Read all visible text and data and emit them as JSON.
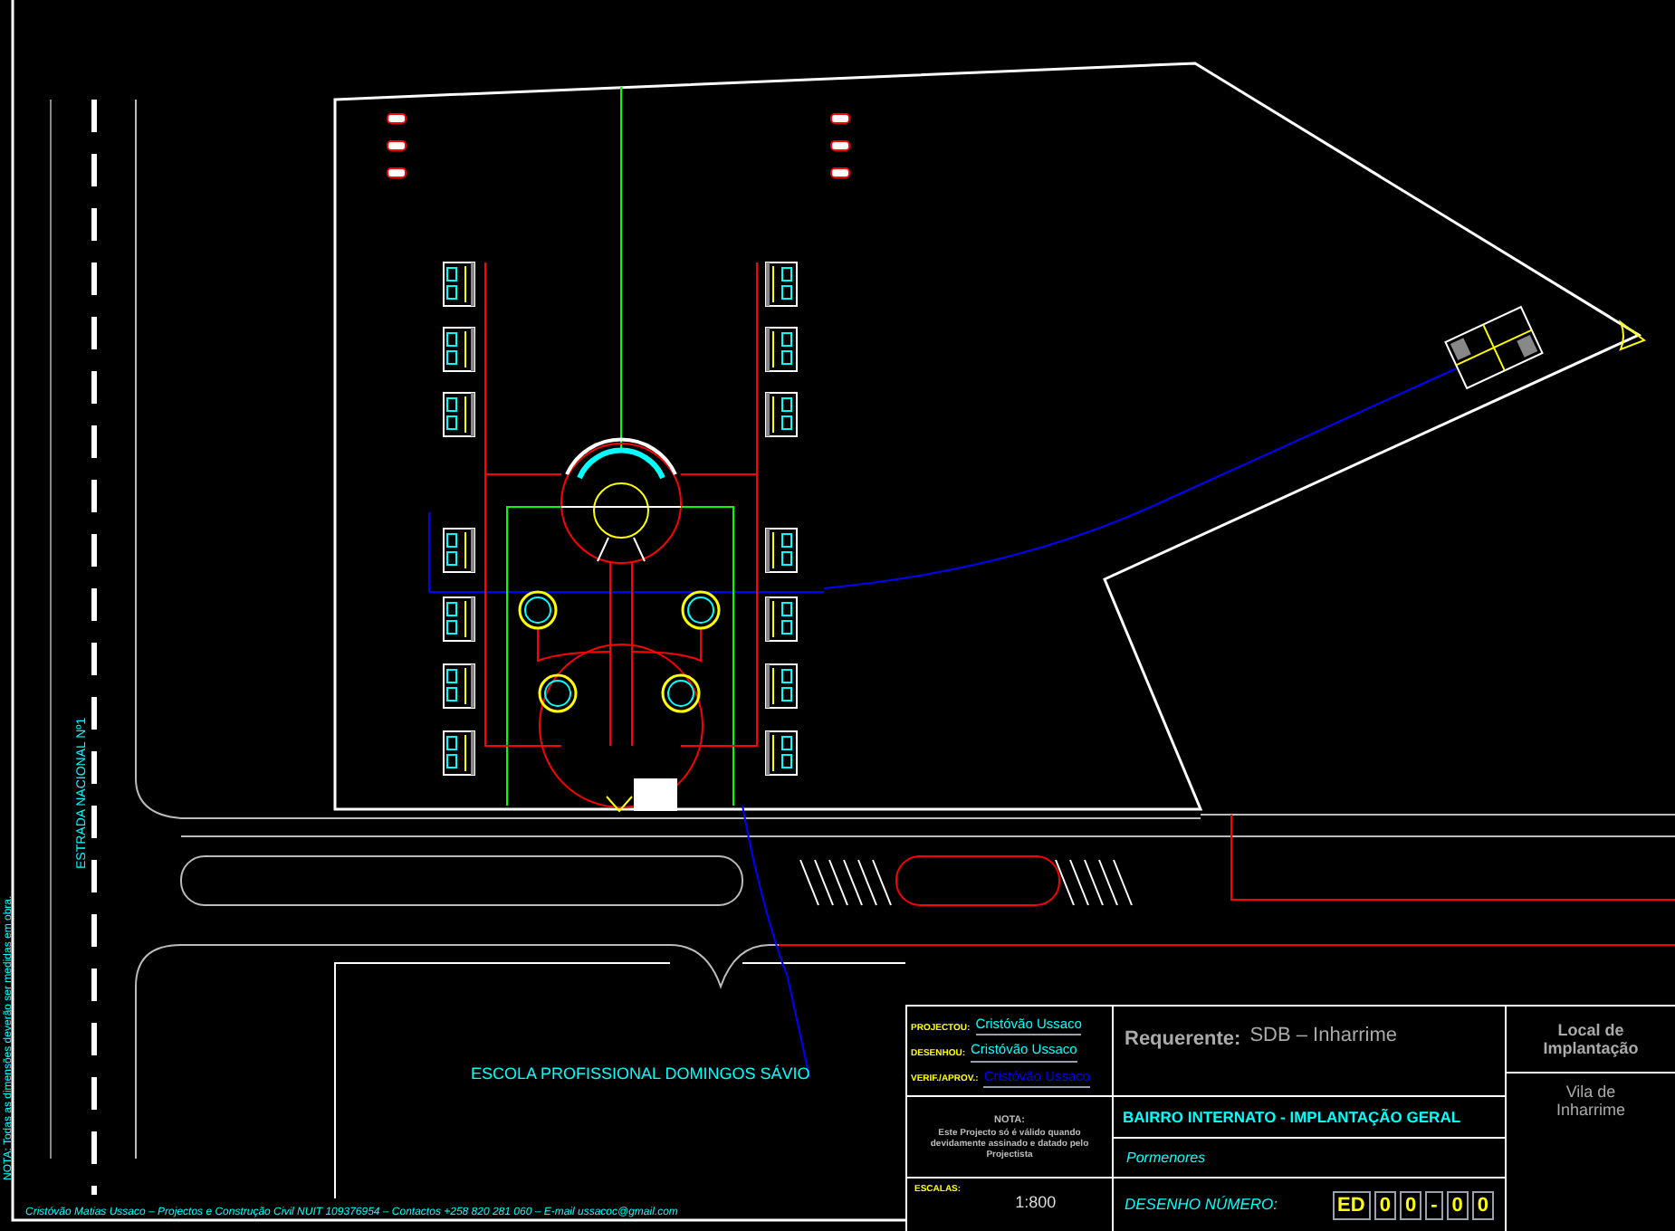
{
  "drawing": {
    "road_label": "ESTRADA NACIONAL Nº1",
    "side_note": "NOTA: Todas as dimensões deverão ser medidas em obra.",
    "school_label": "ESCOLA PROFISSIONAL DOMINGOS SÁVIO",
    "footer": "Cristóvão Matias Ussaco – Projectos e Construção Civil  NUIT 109376954  –  Contactos +258 820 281 060  –  E-mail ussacoc@gmail.com"
  },
  "title_block": {
    "credits": [
      {
        "role": "PROJECTOU:",
        "name": "Cristóvão Ussaco",
        "color": "#00ffff"
      },
      {
        "role": "DESENHOU:",
        "name": "Cristóvão Ussaco",
        "color": "#00ffff"
      },
      {
        "role": "VERIF./APROV.:",
        "name": "Cristóvão Ussaco",
        "color": "#0000ff"
      }
    ],
    "note_title": "NOTA:",
    "note": "Este Projecto só é válido quando devidamente assinado e datado pelo Projectista",
    "scale_label": "ESCALAS:",
    "scale": "1:800",
    "requester_label": "Requerente:",
    "requester": "SDB – Inharrime",
    "project_title": "BAIRRO INTERNATO - IMPLANTAÇÃO GERAL",
    "subtitle": "Pormenores",
    "drawing_number_label": "DESENHO NÚMERO:",
    "drawing_number": [
      "ED",
      "0",
      "0",
      "-",
      "0",
      "0"
    ],
    "location_label": "Local de Implantação",
    "location": "Vila de Inharrime"
  }
}
